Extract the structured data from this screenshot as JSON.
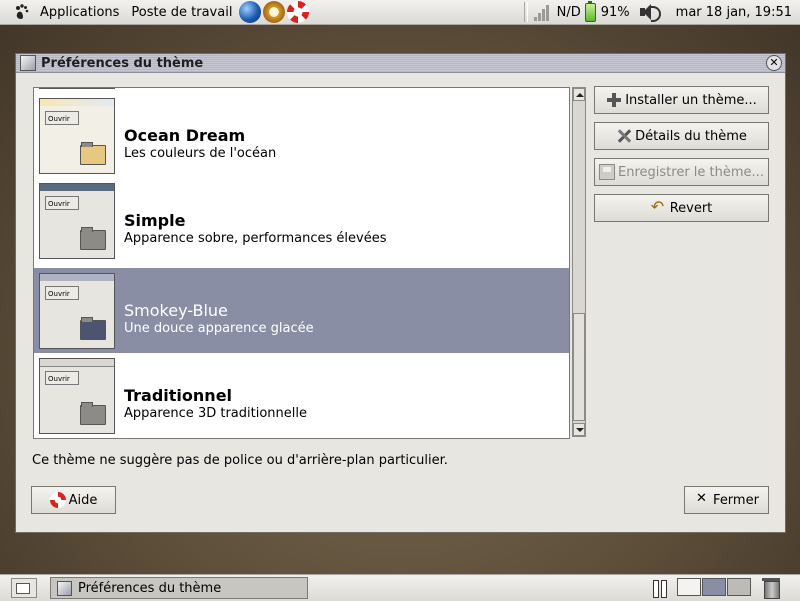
{
  "top_panel": {
    "menus": [
      {
        "label": "Applications"
      },
      {
        "label": "Poste de travail"
      }
    ],
    "launchers": [
      "globe-icon",
      "compass-icon",
      "lifebuoy-icon"
    ],
    "tray": {
      "network_status": "N/D",
      "battery": "91%",
      "battery_level": 0.91,
      "clock": "mar 18 jan, 19:51"
    }
  },
  "window": {
    "title": "Préférences du thème",
    "themes": [
      {
        "name": "Ocean Dream",
        "description": "Les couleurs de l'océan",
        "selected": false,
        "thumb_button": "Ouvrir",
        "accent": "#fbe6b2"
      },
      {
        "name": "Simple",
        "description": "Apparence sobre, performances élevées",
        "selected": false,
        "thumb_button": "Ouvrir",
        "accent": "#5b6b82"
      },
      {
        "name": "Smokey-Blue",
        "description": "Une douce apparence glacée",
        "selected": true,
        "thumb_button": "Ouvrir",
        "accent": "#aeb3c4"
      },
      {
        "name": "Traditionnel",
        "description": "Apparence 3D traditionnelle",
        "selected": false,
        "thumb_button": "Ouvrir",
        "accent": "#d9d7d1"
      }
    ],
    "buttons": {
      "install": "Installer un thème...",
      "details": "Détails du thème",
      "save": "Enregistrer le thème...",
      "revert": "Revert",
      "help": "Aide",
      "close": "Fermer"
    },
    "hint": "Ce thème ne suggère pas de police ou d'arrière-plan particulier."
  },
  "bottom_panel": {
    "task_label": "Préférences du thème"
  },
  "colors": {
    "selection": "#8a8ea5",
    "window_bg": "#e8e6e1"
  }
}
